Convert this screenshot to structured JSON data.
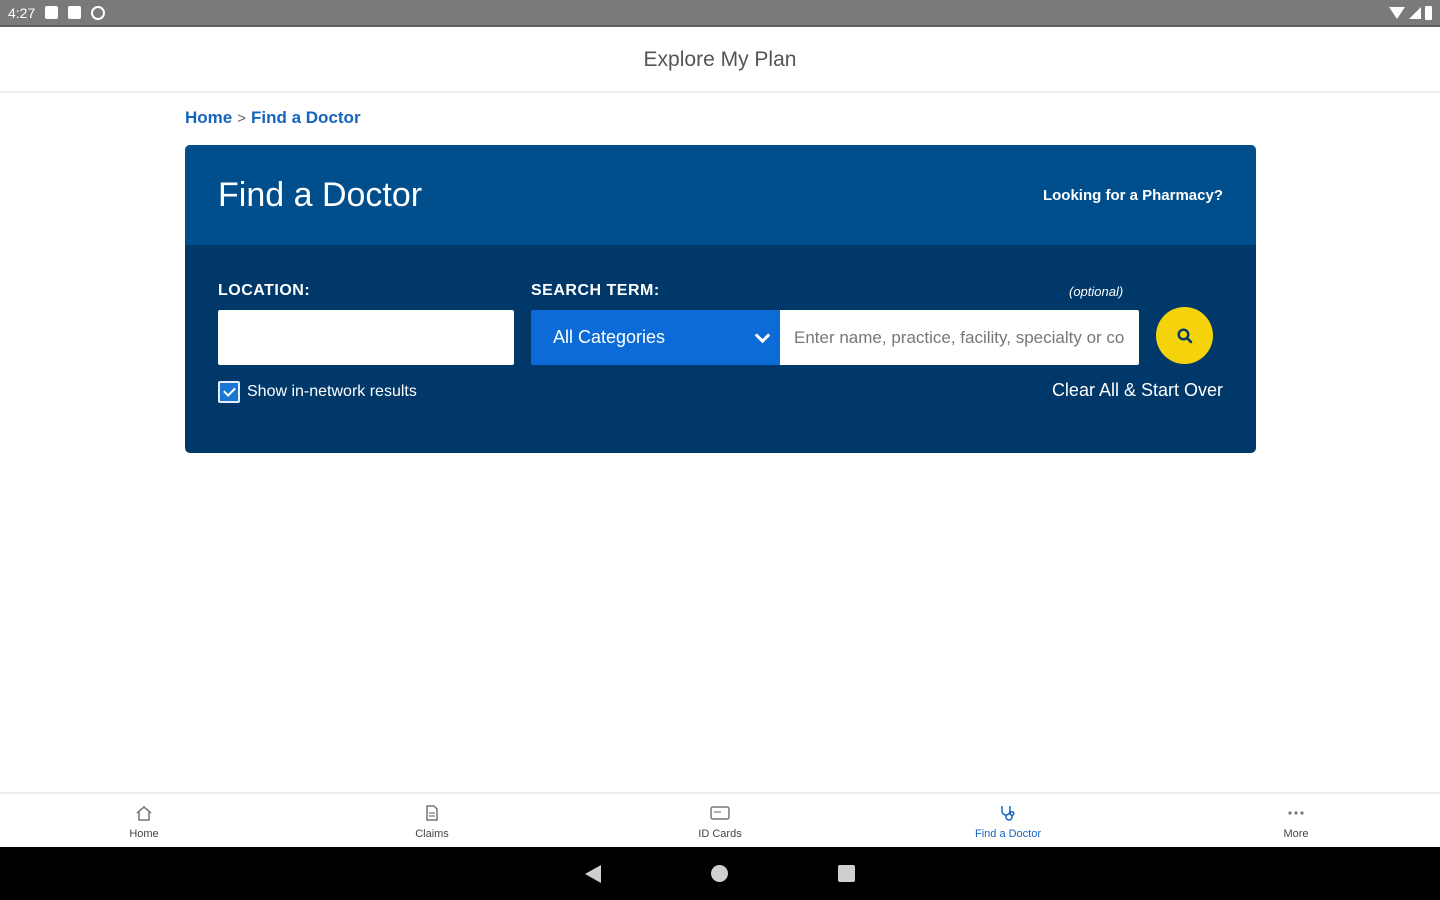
{
  "status_bar": {
    "time": "4:27"
  },
  "app_bar": {
    "title": "Explore My Plan"
  },
  "breadcrumb": {
    "home": "Home",
    "separator": ">",
    "current": "Find a Doctor"
  },
  "card": {
    "title": "Find a Doctor",
    "pharmacy_link": "Looking for a Pharmacy?",
    "location_label": "LOCATION:",
    "location_value": "",
    "search_term_label": "SEARCH TERM:",
    "optional_label": "(optional)",
    "category_selected": "All Categories",
    "search_placeholder": "Enter name, practice, facility, specialty or condition",
    "search_value": "",
    "in_network_label": "Show in-network results",
    "in_network_checked": true,
    "clear_link": "Clear All & Start Over"
  },
  "bottom_nav": {
    "items": [
      {
        "label": "Home",
        "icon": "home-icon"
      },
      {
        "label": "Claims",
        "icon": "claims-icon"
      },
      {
        "label": "ID Cards",
        "icon": "id-card-icon"
      },
      {
        "label": "Find a Doctor",
        "icon": "stethoscope-icon",
        "active": true
      },
      {
        "label": "More",
        "icon": "more-icon"
      }
    ]
  },
  "colors": {
    "card_header": "#004e8c",
    "card_body": "#003869",
    "select_blue": "#0c6bd6",
    "search_button": "#f5d30a",
    "link_blue": "#1565c0"
  }
}
